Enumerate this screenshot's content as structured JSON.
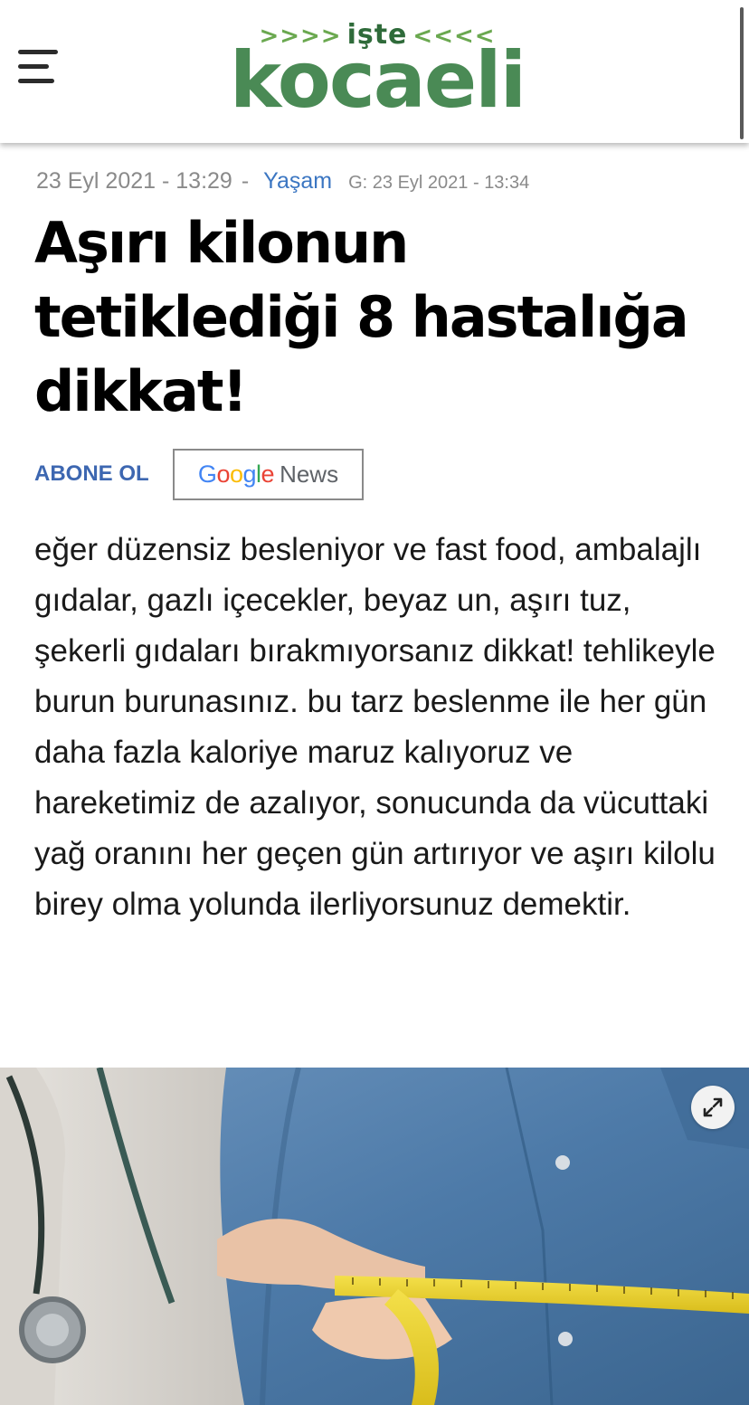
{
  "header": {
    "logo": {
      "arrows_left": ">>>>",
      "top_word": "işte",
      "arrows_right": "<<<<",
      "main_word": "kocaeli"
    }
  },
  "article": {
    "date": "23 Eyl 2021 - 13:29",
    "separator": "-",
    "category": "Yaşam",
    "updated": "G: 23 Eyl 2021 - 13:34",
    "title": "Aşırı kilonun tetiklediği 8 hastalığa dikkat!",
    "subscribe_label": "ABONE OL",
    "google_news": {
      "news": "News"
    },
    "summary": "eğer düzensiz besleniyor ve fast food, ambalajlı gıdalar, gazlı içecekler, beyaz un, aşırı tuz, şekerli gıdaları bırakmıyorsanız dikkat! tehlikeyle burun burunasınız. bu tarz beslenme ile her gün daha fazla kaloriye maruz kalıyoruz ve hareketimiz de azalıyor, sonucunda da vücuttaki yağ oranını her geçen gün artırıyor ve aşırı kilolu birey olma yolunda ilerliyorsunuz demektir."
  },
  "colors": {
    "logo_green": "#4a8a55",
    "category_blue": "#3b76c2",
    "subscribe_blue": "#3d67b1",
    "google": {
      "blue": "#4285F4",
      "red": "#EA4335",
      "yellow": "#FBBC05",
      "green": "#34A853"
    }
  },
  "icons": {
    "menu": "hamburger-menu-icon",
    "expand": "expand-icon"
  }
}
